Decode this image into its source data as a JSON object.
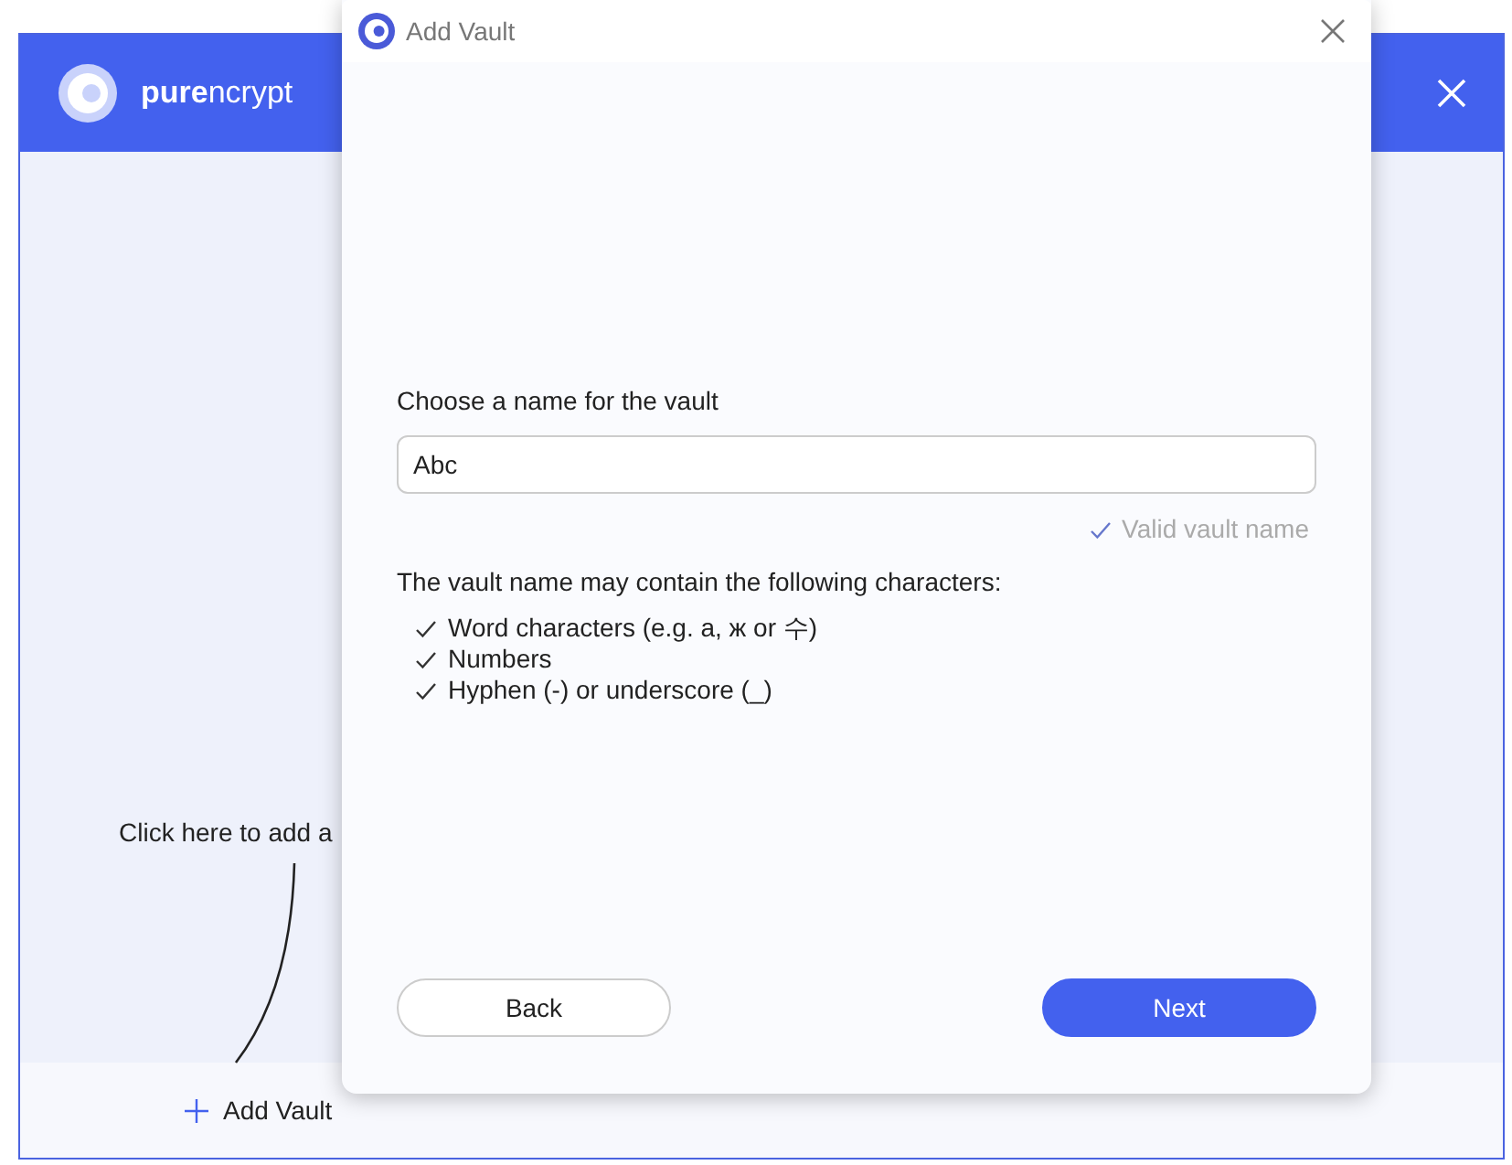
{
  "app": {
    "brand_bold": "pure",
    "brand_rest": "ncrypt",
    "hint": "Click here to add a",
    "add_button": "Add Vault"
  },
  "dialog": {
    "title": "Add Vault",
    "name_label": "Choose a name for the vault",
    "name_field": {
      "value": "Abc"
    },
    "validation": {
      "valid": true,
      "text": "Valid vault name"
    },
    "rules_heading": "The vault name may contain the following characters:",
    "rules": [
      {
        "text": "Word characters (e.g. a, ж or 수)"
      },
      {
        "text": "Numbers"
      },
      {
        "text": "Hyphen (-) or underscore (_)"
      }
    ],
    "buttons": [
      {
        "label": "Back",
        "kind": "secondary"
      },
      {
        "label": "Next",
        "kind": "primary"
      }
    ]
  }
}
